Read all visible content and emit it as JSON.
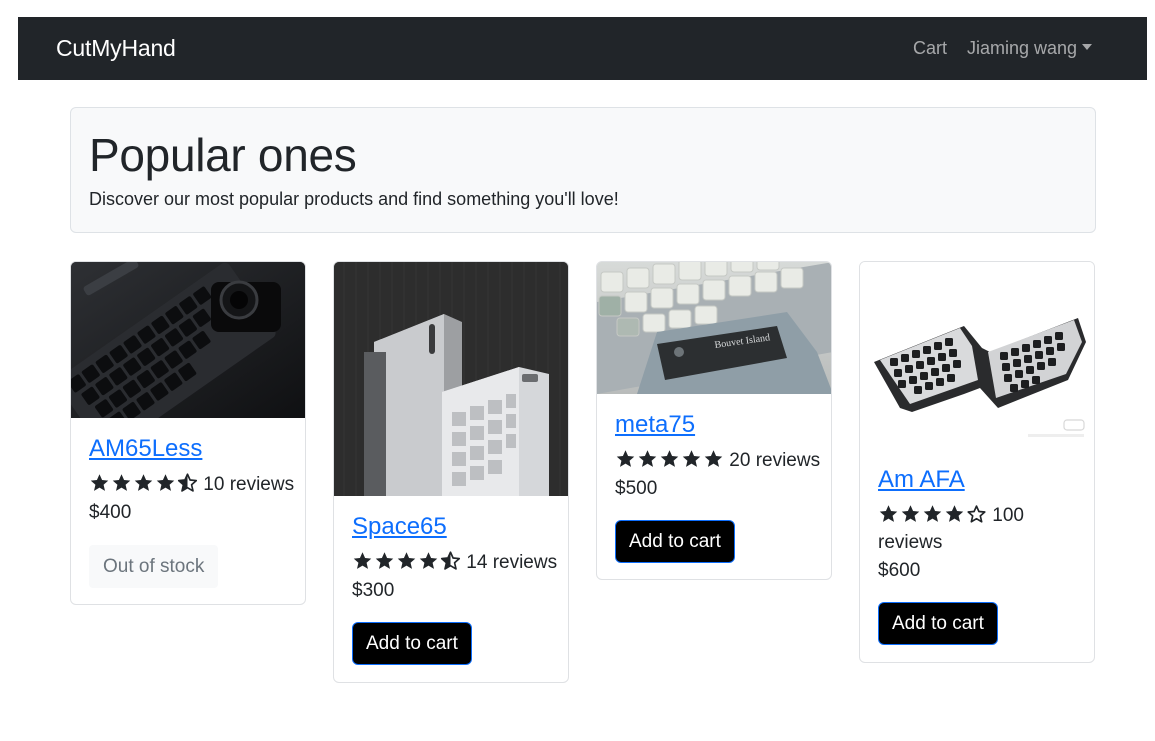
{
  "navbar": {
    "brand": "CutMyHand",
    "cart": "Cart",
    "user": "Jiaming wang"
  },
  "hero": {
    "title": "Popular ones",
    "subtitle": "Discover our most popular products and find something you'll love!"
  },
  "products": [
    {
      "name": "AM65Less",
      "rating": 4.5,
      "reviews": "10 reviews",
      "price": "$400",
      "action": "Out of stock",
      "in_stock": false
    },
    {
      "name": "Space65",
      "rating": 4.5,
      "reviews": "14 reviews",
      "price": "$300",
      "action": "Add to cart",
      "in_stock": true
    },
    {
      "name": "meta75",
      "rating": 5,
      "reviews": "20 reviews",
      "price": "$500",
      "action": "Add to cart",
      "in_stock": true
    },
    {
      "name": "Am AFA",
      "rating": 4,
      "reviews_line1": "100",
      "reviews_line2": "reviews",
      "price": "$600",
      "action": "Add to cart",
      "in_stock": true
    }
  ],
  "image_texts": {
    "meta75_plate": "Bouvet Island"
  },
  "colors": {
    "navbar_bg": "#212529",
    "link": "#0d6efd",
    "button_bg": "#000000",
    "star": "#212529"
  }
}
